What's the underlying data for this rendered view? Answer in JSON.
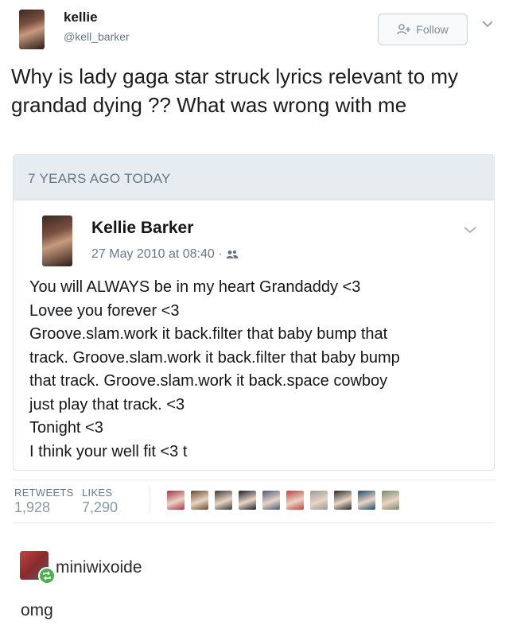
{
  "tweet": {
    "display_name": "kellie",
    "handle": "@kell_barker",
    "follow_label": "Follow",
    "text": "Why is lady gaga star struck lyrics relevant to my grandad dying ?? What was wrong with me"
  },
  "memory": {
    "header": "7 YEARS AGO TODAY",
    "name": "Kellie Barker",
    "date": "27 May 2010 at 08:40",
    "separator": "·",
    "lines": [
      "You will ALWAYS be in my heart Grandaddy <3",
      "Lovee you forever <3",
      "Groove.slam.work it back.filter that baby bump that",
      "track. Groove.slam.work it back.filter that baby bump",
      "that track. Groove.slam.work it back.space cowboy",
      "just play that track. <3",
      "Tonight <3",
      "I think your well fit <3 t"
    ]
  },
  "stats": {
    "retweets_label": "RETWEETS",
    "retweets_value": "1,928",
    "likes_label": "LIKES",
    "likes_value": "7,290"
  },
  "liker_avatars": [
    "#a8324a",
    "#6b4a2e",
    "#3a3a3a",
    "#1c1c2a",
    "#4a5a7a",
    "#c04040",
    "#9a9a9a",
    "#2a2a2a",
    "#1f4a6a",
    "#7a8a6a"
  ],
  "reblog": {
    "username": "miniwixoide",
    "comment": "omg"
  },
  "icons": {
    "follow": "add-user-icon",
    "chevron": "chevron-down-icon",
    "audience": "friends-icon",
    "reblog": "reblog-icon"
  },
  "colors": {
    "reblog_badge": "#4caf50",
    "memory_header_bg": "#e6ecf0"
  }
}
